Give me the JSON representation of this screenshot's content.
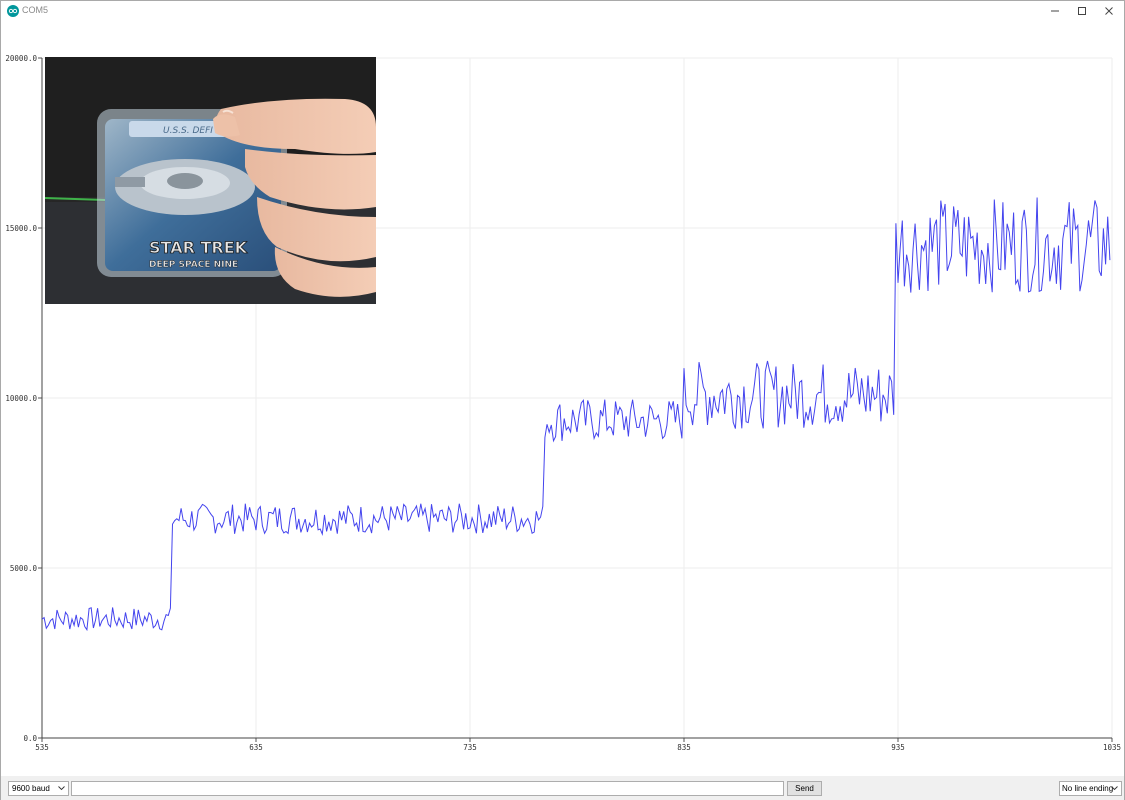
{
  "window": {
    "title": "COM5"
  },
  "plot": {
    "line_color": "#4444ee",
    "grid_color": "#eeeeee",
    "inset_image": "photo-hand-holding-star-trek-deep-space-nine-card"
  },
  "chart_data": {
    "type": "line",
    "title": "",
    "xlabel": "",
    "ylabel": "",
    "xlim": [
      535,
      1035
    ],
    "ylim": [
      0,
      20000
    ],
    "x_ticks": [
      "535",
      "635",
      "735",
      "835",
      "935",
      "1035"
    ],
    "y_ticks": [
      "0.0",
      "5000.0",
      "10000.0",
      "15000.0",
      "20000.0"
    ],
    "grid": true,
    "series": [
      {
        "color": "#4444ee",
        "segments": [
          {
            "x_start": 535,
            "x_end": 596,
            "mean": 3500,
            "amplitude": 350
          },
          {
            "x_start": 596,
            "x_end": 770,
            "mean": 6450,
            "amplitude": 450
          },
          {
            "x_start": 770,
            "x_end": 835,
            "mean": 9350,
            "amplitude": 650
          },
          {
            "x_start": 835,
            "x_end": 934,
            "mean": 10100,
            "amplitude": 1000
          },
          {
            "x_start": 934,
            "x_end": 1035,
            "mean": 14500,
            "amplitude": 1400
          }
        ]
      }
    ]
  },
  "controls": {
    "baud": "9600 baud",
    "input_value": "",
    "send_label": "Send",
    "line_ending": "No line ending"
  }
}
